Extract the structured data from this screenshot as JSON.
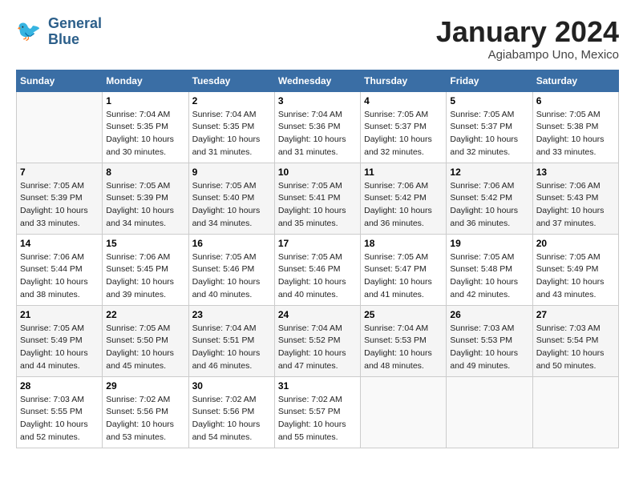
{
  "header": {
    "logo_line1": "General",
    "logo_line2": "Blue",
    "month": "January 2024",
    "location": "Agiabampo Uno, Mexico"
  },
  "weekdays": [
    "Sunday",
    "Monday",
    "Tuesday",
    "Wednesday",
    "Thursday",
    "Friday",
    "Saturday"
  ],
  "weeks": [
    [
      {
        "day": "",
        "sunrise": "",
        "sunset": "",
        "daylight": ""
      },
      {
        "day": "1",
        "sunrise": "Sunrise: 7:04 AM",
        "sunset": "Sunset: 5:35 PM",
        "daylight": "Daylight: 10 hours and 30 minutes."
      },
      {
        "day": "2",
        "sunrise": "Sunrise: 7:04 AM",
        "sunset": "Sunset: 5:35 PM",
        "daylight": "Daylight: 10 hours and 31 minutes."
      },
      {
        "day": "3",
        "sunrise": "Sunrise: 7:04 AM",
        "sunset": "Sunset: 5:36 PM",
        "daylight": "Daylight: 10 hours and 31 minutes."
      },
      {
        "day": "4",
        "sunrise": "Sunrise: 7:05 AM",
        "sunset": "Sunset: 5:37 PM",
        "daylight": "Daylight: 10 hours and 32 minutes."
      },
      {
        "day": "5",
        "sunrise": "Sunrise: 7:05 AM",
        "sunset": "Sunset: 5:37 PM",
        "daylight": "Daylight: 10 hours and 32 minutes."
      },
      {
        "day": "6",
        "sunrise": "Sunrise: 7:05 AM",
        "sunset": "Sunset: 5:38 PM",
        "daylight": "Daylight: 10 hours and 33 minutes."
      }
    ],
    [
      {
        "day": "7",
        "sunrise": "Sunrise: 7:05 AM",
        "sunset": "Sunset: 5:39 PM",
        "daylight": "Daylight: 10 hours and 33 minutes."
      },
      {
        "day": "8",
        "sunrise": "Sunrise: 7:05 AM",
        "sunset": "Sunset: 5:39 PM",
        "daylight": "Daylight: 10 hours and 34 minutes."
      },
      {
        "day": "9",
        "sunrise": "Sunrise: 7:05 AM",
        "sunset": "Sunset: 5:40 PM",
        "daylight": "Daylight: 10 hours and 34 minutes."
      },
      {
        "day": "10",
        "sunrise": "Sunrise: 7:05 AM",
        "sunset": "Sunset: 5:41 PM",
        "daylight": "Daylight: 10 hours and 35 minutes."
      },
      {
        "day": "11",
        "sunrise": "Sunrise: 7:06 AM",
        "sunset": "Sunset: 5:42 PM",
        "daylight": "Daylight: 10 hours and 36 minutes."
      },
      {
        "day": "12",
        "sunrise": "Sunrise: 7:06 AM",
        "sunset": "Sunset: 5:42 PM",
        "daylight": "Daylight: 10 hours and 36 minutes."
      },
      {
        "day": "13",
        "sunrise": "Sunrise: 7:06 AM",
        "sunset": "Sunset: 5:43 PM",
        "daylight": "Daylight: 10 hours and 37 minutes."
      }
    ],
    [
      {
        "day": "14",
        "sunrise": "Sunrise: 7:06 AM",
        "sunset": "Sunset: 5:44 PM",
        "daylight": "Daylight: 10 hours and 38 minutes."
      },
      {
        "day": "15",
        "sunrise": "Sunrise: 7:06 AM",
        "sunset": "Sunset: 5:45 PM",
        "daylight": "Daylight: 10 hours and 39 minutes."
      },
      {
        "day": "16",
        "sunrise": "Sunrise: 7:05 AM",
        "sunset": "Sunset: 5:46 PM",
        "daylight": "Daylight: 10 hours and 40 minutes."
      },
      {
        "day": "17",
        "sunrise": "Sunrise: 7:05 AM",
        "sunset": "Sunset: 5:46 PM",
        "daylight": "Daylight: 10 hours and 40 minutes."
      },
      {
        "day": "18",
        "sunrise": "Sunrise: 7:05 AM",
        "sunset": "Sunset: 5:47 PM",
        "daylight": "Daylight: 10 hours and 41 minutes."
      },
      {
        "day": "19",
        "sunrise": "Sunrise: 7:05 AM",
        "sunset": "Sunset: 5:48 PM",
        "daylight": "Daylight: 10 hours and 42 minutes."
      },
      {
        "day": "20",
        "sunrise": "Sunrise: 7:05 AM",
        "sunset": "Sunset: 5:49 PM",
        "daylight": "Daylight: 10 hours and 43 minutes."
      }
    ],
    [
      {
        "day": "21",
        "sunrise": "Sunrise: 7:05 AM",
        "sunset": "Sunset: 5:49 PM",
        "daylight": "Daylight: 10 hours and 44 minutes."
      },
      {
        "day": "22",
        "sunrise": "Sunrise: 7:05 AM",
        "sunset": "Sunset: 5:50 PM",
        "daylight": "Daylight: 10 hours and 45 minutes."
      },
      {
        "day": "23",
        "sunrise": "Sunrise: 7:04 AM",
        "sunset": "Sunset: 5:51 PM",
        "daylight": "Daylight: 10 hours and 46 minutes."
      },
      {
        "day": "24",
        "sunrise": "Sunrise: 7:04 AM",
        "sunset": "Sunset: 5:52 PM",
        "daylight": "Daylight: 10 hours and 47 minutes."
      },
      {
        "day": "25",
        "sunrise": "Sunrise: 7:04 AM",
        "sunset": "Sunset: 5:53 PM",
        "daylight": "Daylight: 10 hours and 48 minutes."
      },
      {
        "day": "26",
        "sunrise": "Sunrise: 7:03 AM",
        "sunset": "Sunset: 5:53 PM",
        "daylight": "Daylight: 10 hours and 49 minutes."
      },
      {
        "day": "27",
        "sunrise": "Sunrise: 7:03 AM",
        "sunset": "Sunset: 5:54 PM",
        "daylight": "Daylight: 10 hours and 50 minutes."
      }
    ],
    [
      {
        "day": "28",
        "sunrise": "Sunrise: 7:03 AM",
        "sunset": "Sunset: 5:55 PM",
        "daylight": "Daylight: 10 hours and 52 minutes."
      },
      {
        "day": "29",
        "sunrise": "Sunrise: 7:02 AM",
        "sunset": "Sunset: 5:56 PM",
        "daylight": "Daylight: 10 hours and 53 minutes."
      },
      {
        "day": "30",
        "sunrise": "Sunrise: 7:02 AM",
        "sunset": "Sunset: 5:56 PM",
        "daylight": "Daylight: 10 hours and 54 minutes."
      },
      {
        "day": "31",
        "sunrise": "Sunrise: 7:02 AM",
        "sunset": "Sunset: 5:57 PM",
        "daylight": "Daylight: 10 hours and 55 minutes."
      },
      {
        "day": "",
        "sunrise": "",
        "sunset": "",
        "daylight": ""
      },
      {
        "day": "",
        "sunrise": "",
        "sunset": "",
        "daylight": ""
      },
      {
        "day": "",
        "sunrise": "",
        "sunset": "",
        "daylight": ""
      }
    ]
  ]
}
